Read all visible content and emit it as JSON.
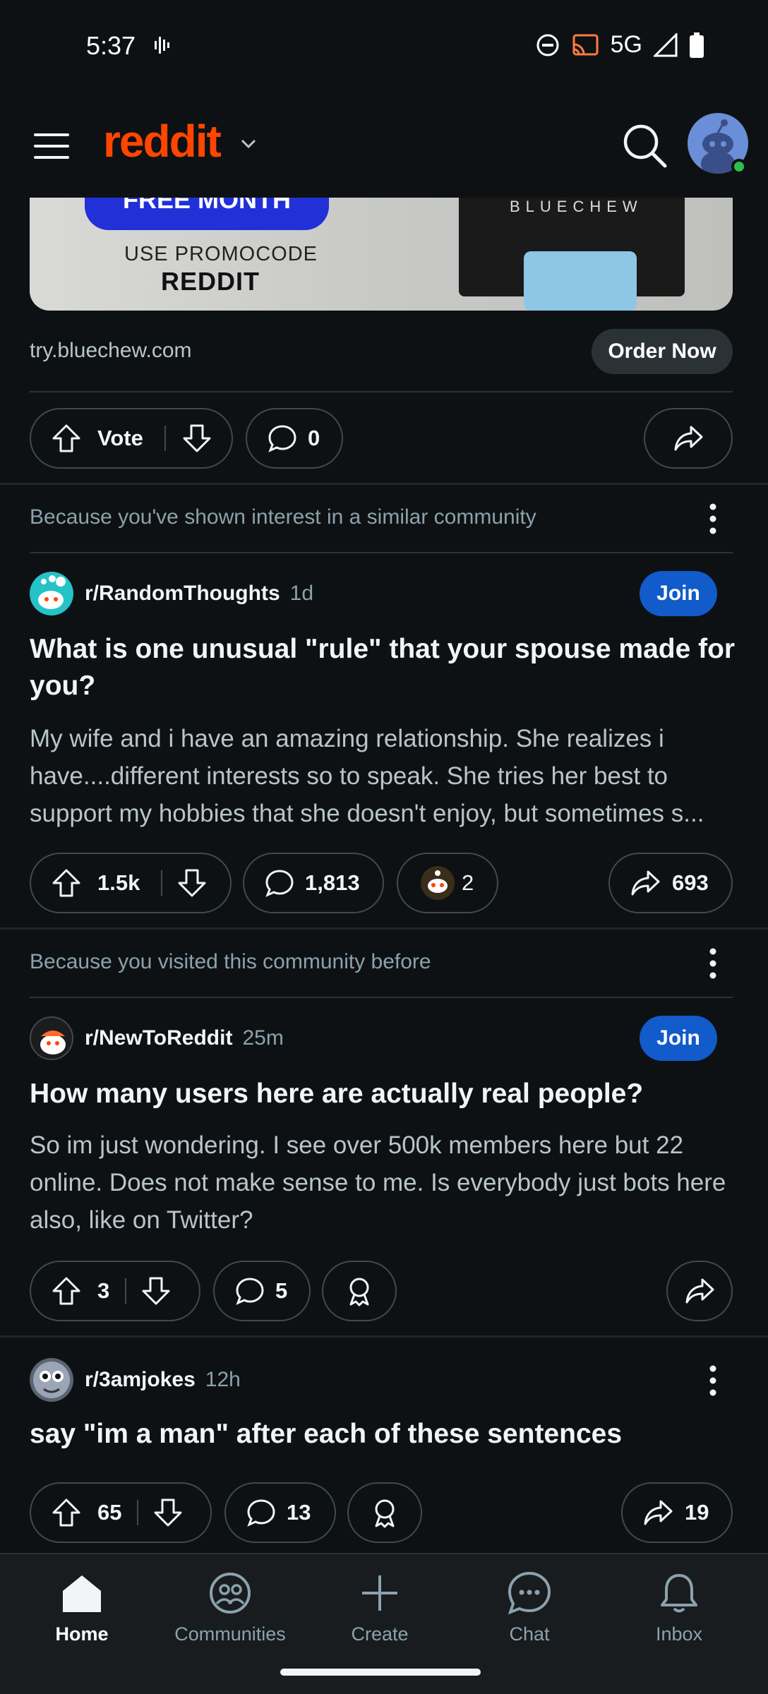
{
  "status_bar": {
    "time": "5:37",
    "network": "5G",
    "icons": [
      "sound-wave-icon",
      "do-not-disturb-icon",
      "cast-icon",
      "signal-icon",
      "battery-icon"
    ]
  },
  "header": {
    "logo_text": "reddit",
    "brand_color": "#ff4500"
  },
  "ad": {
    "image_pill_text": "FREE MONTH",
    "image_promo_line1": "USE PROMOCODE",
    "image_promo_line2": "REDDIT",
    "image_shirt_text": "BLUECHEW",
    "domain": "try.bluechew.com",
    "cta_label": "Order Now",
    "vote_label": "Vote",
    "comment_count": "0"
  },
  "posts": [
    {
      "reason": "Because you've shown interest in a similar community",
      "subreddit": "r/RandomThoughts",
      "age": "1d",
      "join_label": "Join",
      "title": "What is one unusual \"rule\" that your spouse made for you?",
      "body": "My wife and i have an amazing relationship. She realizes i have....different interests so to speak. She tries her best to support my hobbies that she doesn't enjoy, but sometimes s...",
      "votes": "1.5k",
      "comments": "1,813",
      "awards": "2",
      "shares": "693"
    },
    {
      "reason": "Because you visited this community before",
      "subreddit": "r/NewToReddit",
      "age": "25m",
      "join_label": "Join",
      "title": "How many users here are actually real people?",
      "body": "So im just wondering. I see over 500k members here but 22 online. Does not make sense to me. Is everybody just bots here also, like on Twitter?",
      "votes": "3",
      "comments": "5"
    },
    {
      "subreddit": "r/3amjokes",
      "age": "12h",
      "title": "say \"im a man\" after each of these sentences",
      "votes": "65",
      "comments": "13",
      "shares": "19"
    }
  ],
  "nav": {
    "home": "Home",
    "communities": "Communities",
    "create": "Create",
    "chat": "Chat",
    "inbox": "Inbox"
  },
  "colors": {
    "background": "#0e1113",
    "join_button": "#115bca",
    "secondary_text": "#8ba2ad"
  }
}
